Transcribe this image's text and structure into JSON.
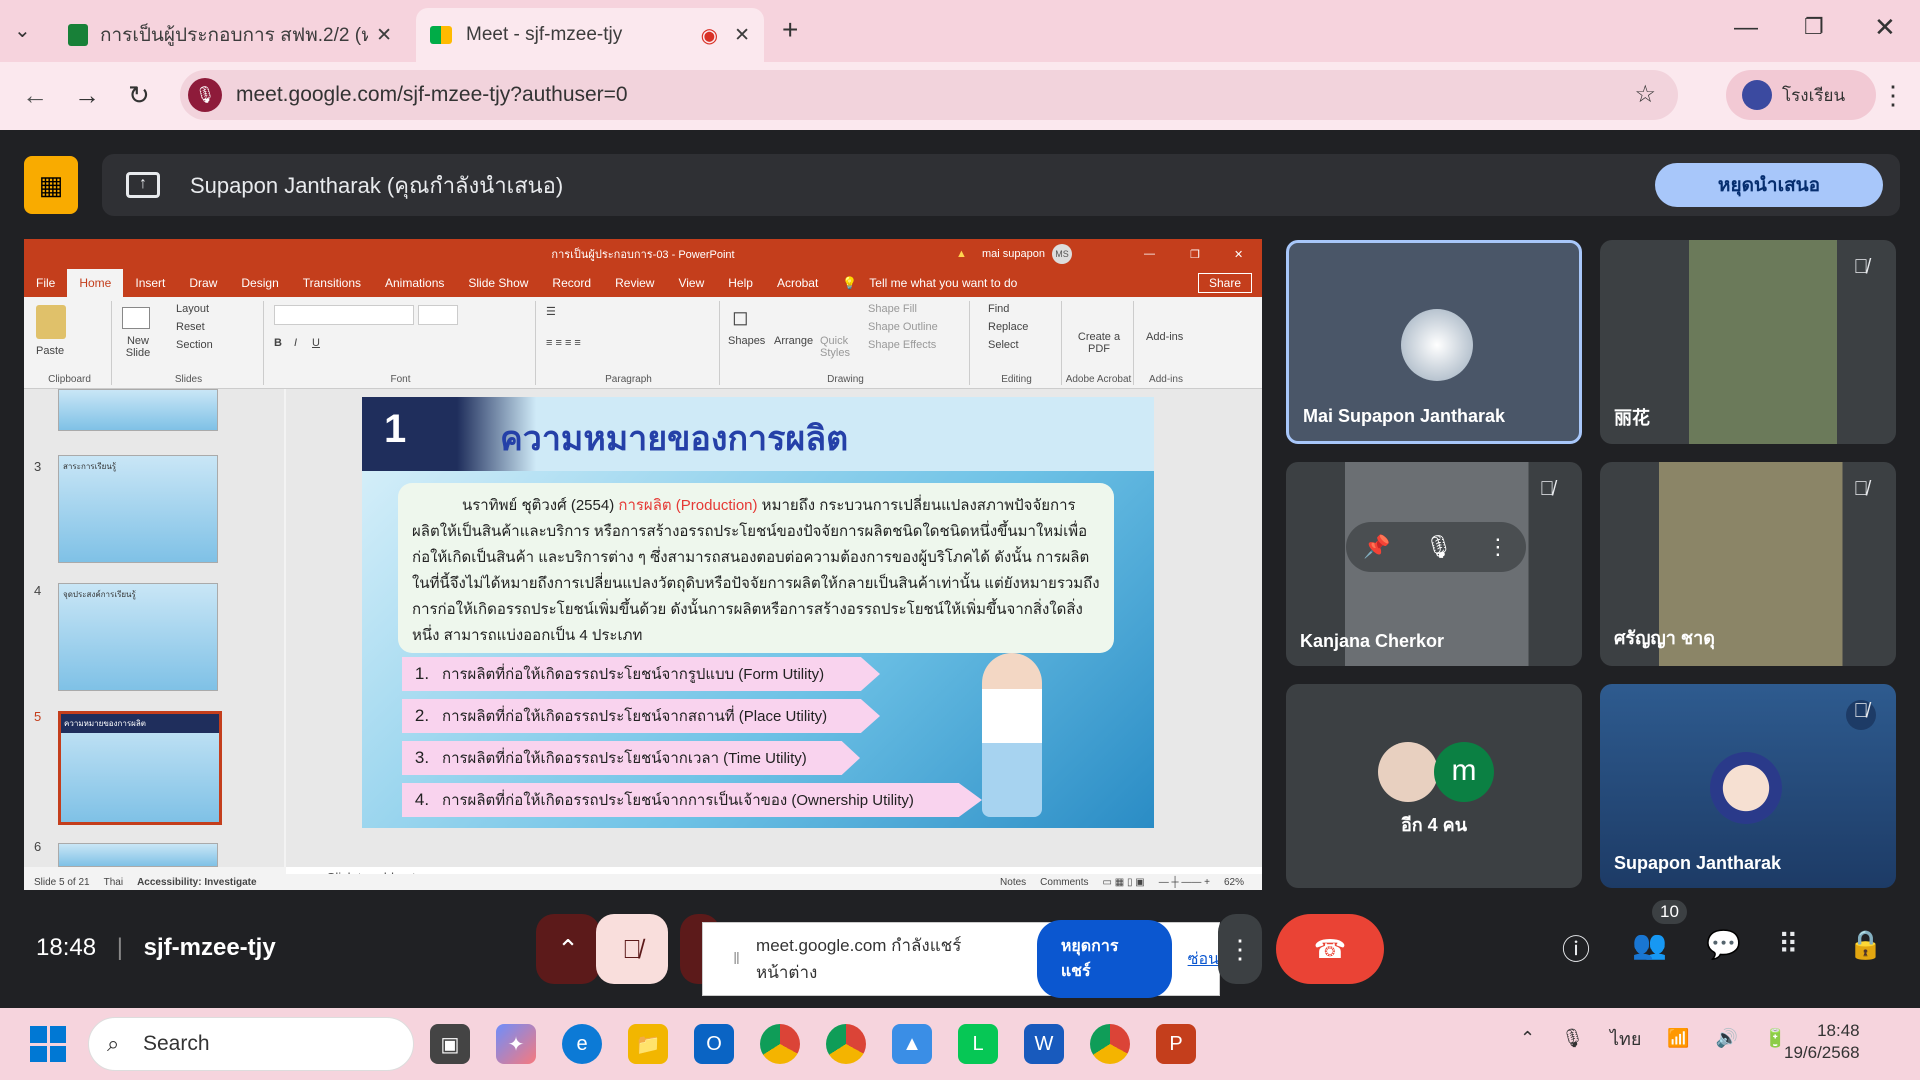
{
  "browser": {
    "tabs": [
      {
        "label": "การเป็นผู้ประกอบการ สฟพ.2/2 (หวิ...",
        "active": false
      },
      {
        "label": "Meet - sjf-mzee-tjy",
        "active": true
      }
    ],
    "new_tab": "+",
    "url": "meet.google.com/sjf-mzee-tjy?authuser=0",
    "profile": "โรงเรียน"
  },
  "meet": {
    "presenter": "Supapon Jantharak (คุณกำลังนำเสนอ)",
    "stop_presenting": "หยุดนำเสนอ",
    "time": "18:48",
    "meeting_code": "sjf-mzee-tjy",
    "participants": [
      {
        "name": "Mai Supapon Jantharak"
      },
      {
        "name": "丽花"
      },
      {
        "name": "Kanjana Cherkor"
      },
      {
        "name": "ศรัญญา ชาดุ"
      },
      {
        "name": "อีก 4 คน",
        "initial": "m"
      },
      {
        "name": "Supapon Jantharak"
      }
    ],
    "people_count": "10",
    "share_notice": {
      "text": "meet.google.com กำลังแชร์หน้าต่าง",
      "stop": "หยุดการแชร์",
      "hide": "ซ่อน"
    }
  },
  "powerpoint": {
    "title": "การเป็นผู้ประกอบการ-03 - PowerPoint",
    "user": "mai supapon",
    "user_initials": "MS",
    "menu": [
      "File",
      "Home",
      "Insert",
      "Draw",
      "Design",
      "Transitions",
      "Animations",
      "Slide Show",
      "Record",
      "Review",
      "View",
      "Help",
      "Acrobat"
    ],
    "tell_me": "Tell me what you want to do",
    "share": "Share",
    "ribbon": {
      "clipboard": {
        "paste": "Paste",
        "label": "Clipboard"
      },
      "slides": {
        "new_slide": "New Slide",
        "layout": "Layout",
        "reset": "Reset",
        "section": "Section",
        "label": "Slides"
      },
      "font": "Font",
      "paragraph": "Paragraph",
      "drawing": {
        "shapes": "Shapes",
        "arrange": "Arrange",
        "quick_styles": "Quick Styles",
        "shape_fill": "Shape Fill",
        "shape_outline": "Shape Outline",
        "shape_effects": "Shape Effects",
        "label": "Drawing"
      },
      "editing": {
        "find": "Find",
        "replace": "Replace",
        "select": "Select",
        "label": "Editing"
      },
      "acrobat": {
        "create_pdf": "Create a PDF",
        "label": "Adobe Acrobat"
      },
      "addins": {
        "addins": "Add-ins",
        "label": "Add-ins"
      }
    },
    "thumbnails": [
      {
        "num": "3",
        "title": "สาระการเรียนรู้"
      },
      {
        "num": "4",
        "title": "จุดประสงค์การเรียนรู้"
      },
      {
        "num": "5",
        "title": "ความหมายของการผลิต"
      },
      {
        "num": "6",
        "title": ""
      }
    ],
    "slide": {
      "number": "1",
      "title": "ความหมายของการผลิต",
      "body_pre": "นราทิพย์ ชุติวงศ์ (2554) ",
      "body_red": "การผลิต (Production)",
      "body_post": " หมายถึง กระบวนการเปลี่ยนแปลงสภาพปัจจัยการผลิตให้เป็นสินค้าและบริการ หรือการสร้างอรรถประโยชน์ของปัจจัยการผลิตชนิดใดชนิดหนึ่งขึ้นมาใหม่เพื่อก่อให้เกิดเป็นสินค้า และบริการต่าง ๆ ซึ่งสามารถสนองตอบต่อความต้องการของผู้บริโภคได้ ดังนั้น การผลิตในที่นี้จึงไม่ได้หมายถึงการเปลี่ยนแปลงวัตถุดิบหรือปัจจัยการผลิตให้กลายเป็นสินค้าเท่านั้น แต่ยังหมายรวมถึงการก่อให้เกิดอรรถประโยชน์เพิ่มขึ้นด้วย ดังนั้นการผลิตหรือการสร้างอรรถประโยชน์ให้เพิ่มขึ้นจากสิ่งใดสิ่งหนึ่ง สามารถแบ่งออกเป็น 4 ประเภท",
      "items": [
        {
          "n": "1.",
          "text": "การผลิตที่ก่อให้เกิดอรรถประโยชน์จากรูปแบบ (Form Utility)"
        },
        {
          "n": "2.",
          "text": "การผลิตที่ก่อให้เกิดอรรถประโยชน์จากสถานที่ (Place Utility)"
        },
        {
          "n": "3.",
          "text": "การผลิตที่ก่อให้เกิดอรรถประโยชน์จากเวลา (Time Utility)"
        },
        {
          "n": "4.",
          "text": "การผลิตที่ก่อให้เกิดอรรถประโยชน์จากการเป็นเจ้าของ (Ownership Utility)"
        }
      ]
    },
    "notes_placeholder": "Click to add notes",
    "status": {
      "slide": "Slide 5 of 21",
      "lang": "Thai",
      "accessibility": "Accessibility: Investigate",
      "notes": "Notes",
      "comments": "Comments",
      "zoom": "62%"
    }
  },
  "taskbar": {
    "search": "Search",
    "lang": "ไทย",
    "time": "18:48",
    "date": "19/6/2568"
  },
  "colors": {
    "ppt_red": "#c43e1c",
    "meet_dark": "#202124",
    "stop_blue": "#a8c7fa",
    "end_call": "#ea4335"
  }
}
